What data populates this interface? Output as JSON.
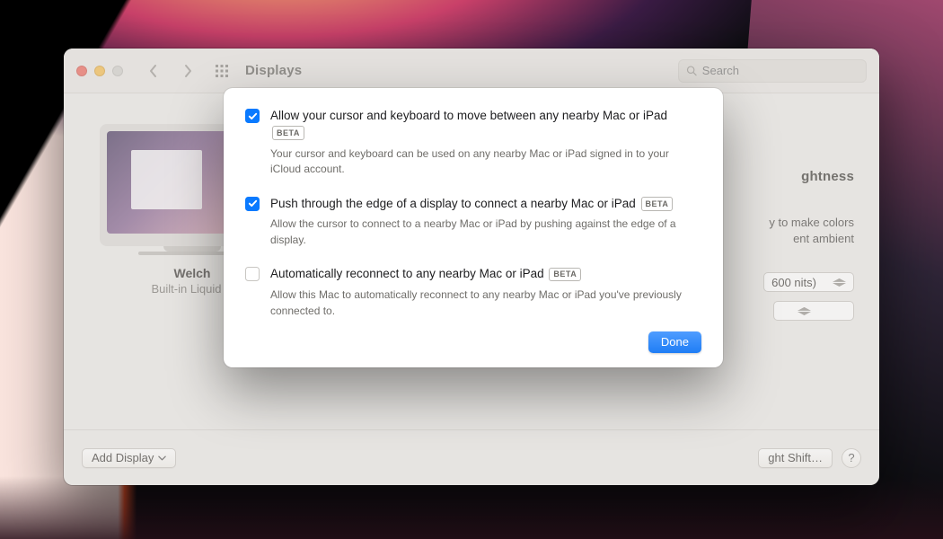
{
  "window": {
    "title": "Displays",
    "search_placeholder": "Search"
  },
  "display": {
    "name": "Welch",
    "subtitle": "Built-in Liquid R"
  },
  "settings": {
    "brightness_label": "ghtness",
    "auto_brightness_partial1": "y to make colors",
    "auto_brightness_partial2": "ent ambient",
    "preset_value": "600 nits)"
  },
  "footbar": {
    "add_display": "Add Display",
    "night_shift": "ght Shift…",
    "help": "?"
  },
  "modal": {
    "options": [
      {
        "checked": true,
        "title": "Allow your cursor and keyboard to move between any nearby Mac or iPad",
        "badge": "BETA",
        "description": "Your cursor and keyboard can be used on any nearby Mac or iPad signed in to your iCloud account."
      },
      {
        "checked": true,
        "title": "Push through the edge of a display to connect a nearby Mac or iPad",
        "badge": "BETA",
        "description": "Allow the cursor to connect to a nearby Mac or iPad by pushing against the edge of a display."
      },
      {
        "checked": false,
        "title": "Automatically reconnect to any nearby Mac or iPad",
        "badge": "BETA",
        "description": "Allow this Mac to automatically reconnect to any nearby Mac or iPad you've previously connected to."
      }
    ],
    "done": "Done"
  }
}
